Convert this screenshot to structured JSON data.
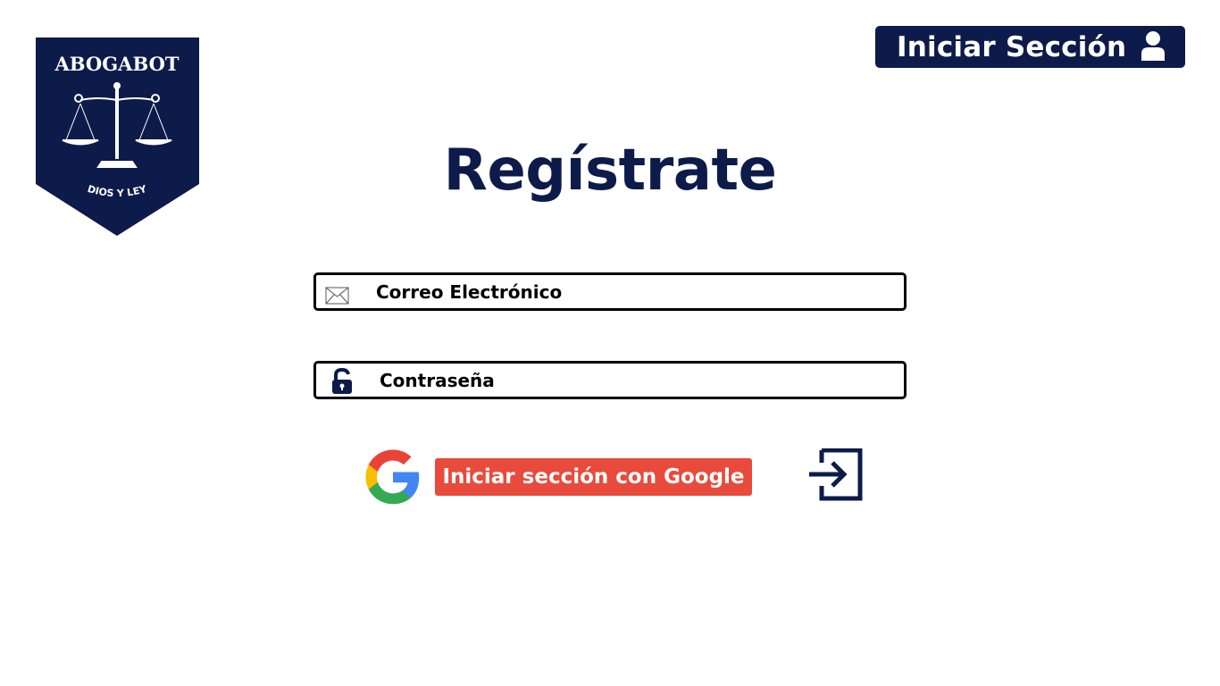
{
  "logo": {
    "name": "ABOGABOT",
    "motto": "DIOS Y LEY",
    "icon": "scales-of-justice-icon"
  },
  "header": {
    "login_label": "Iniciar Sección",
    "login_icon": "user-icon"
  },
  "title": "Regístrate",
  "form": {
    "email": {
      "placeholder": "Correo Electrónico",
      "value": "",
      "icon": "envelope-icon"
    },
    "password": {
      "placeholder": "Contraseña",
      "value": "",
      "icon": "unlocked-padlock-icon"
    }
  },
  "google": {
    "label": "Iniciar sección con Google",
    "icon": "google-logo-icon"
  },
  "submit": {
    "icon": "enter-arrow-icon"
  },
  "colors": {
    "navy": "#0d1b4a",
    "google_red": "#e84a3c",
    "white": "#ffffff"
  }
}
